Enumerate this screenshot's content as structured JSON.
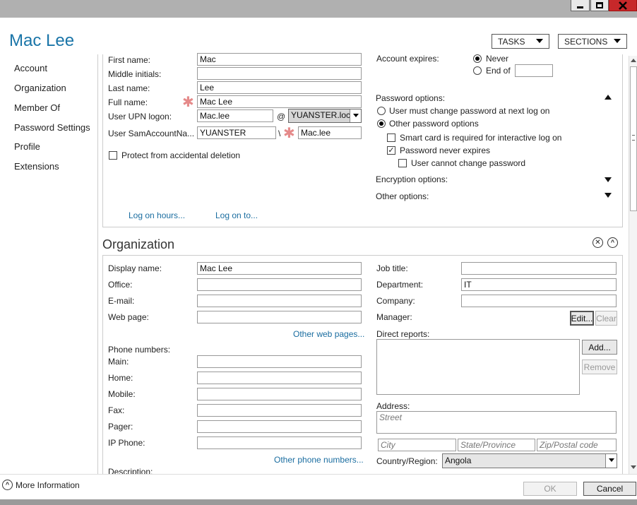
{
  "window": {
    "title": "Mac Lee"
  },
  "header": {
    "tasks_label": "TASKS",
    "sections_label": "SECTIONS"
  },
  "nav": [
    "Account",
    "Organization",
    "Member Of",
    "Password Settings",
    "Profile",
    "Extensions"
  ],
  "account": {
    "first_name_label": "First name:",
    "first_name": "Mac",
    "middle_initials_label": "Middle initials:",
    "middle_initials": "",
    "last_name_label": "Last name:",
    "last_name": "Lee",
    "full_name_label": "Full name:",
    "full_name": "Mac Lee",
    "upn_label": "User UPN logon:",
    "upn_user": "Mac.lee",
    "upn_at": "@",
    "upn_domain": "YUANSTER.local",
    "sam_label": "User SamAccountNa...",
    "sam_domain": "YUANSTER",
    "sam_sep": "\\",
    "sam_user": "Mac.lee",
    "protect_label": "Protect from accidental deletion",
    "logon_hours_link": "Log on hours...",
    "logon_to_link": "Log on to...",
    "expires_label": "Account expires:",
    "never_label": "Never",
    "end_of_label": "End of",
    "end_of_value": "",
    "password_options_label": "Password options:",
    "must_change_label": "User must change password at next log on",
    "other_options_label": "Other password options",
    "smart_card_label": "Smart card is required for interactive log on",
    "never_expires_label": "Password never expires",
    "cannot_change_label": "User cannot change password",
    "encryption_label": "Encryption options:",
    "other_label": "Other options:"
  },
  "organization": {
    "title": "Organization",
    "display_name_label": "Display name:",
    "display_name": "Mac Lee",
    "office_label": "Office:",
    "office": "",
    "email_label": "E-mail:",
    "email": "",
    "web_page_label": "Web page:",
    "web_page": "",
    "other_web_link": "Other web pages...",
    "phone_numbers_label": "Phone numbers:",
    "main_label": "Main:",
    "home_label": "Home:",
    "mobile_label": "Mobile:",
    "fax_label": "Fax:",
    "pager_label": "Pager:",
    "ip_phone_label": "IP Phone:",
    "other_phone_link": "Other phone numbers...",
    "description_label": "Description:",
    "job_title_label": "Job title:",
    "job_title": "",
    "department_label": "Department:",
    "department": "IT",
    "company_label": "Company:",
    "company": "",
    "manager_label": "Manager:",
    "edit_label": "Edit...",
    "clear_label": "Clear",
    "direct_reports_label": "Direct reports:",
    "add_label": "Add...",
    "remove_label": "Remove",
    "address_label": "Address:",
    "street_placeholder": "Street",
    "city_placeholder": "City",
    "state_placeholder": "State/Province",
    "zip_placeholder": "Zip/Postal code",
    "country_label": "Country/Region:",
    "country": "Angola"
  },
  "footer": {
    "more_info": "More Information",
    "ok_label": "OK",
    "cancel_label": "Cancel"
  }
}
